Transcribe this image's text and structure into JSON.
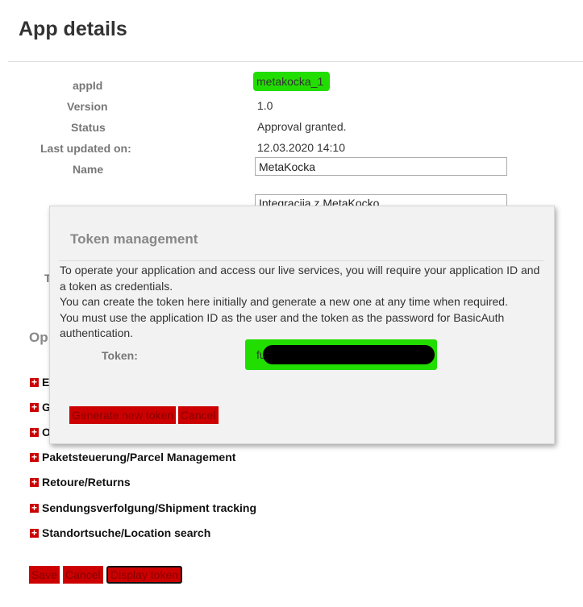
{
  "page": {
    "title": "App details"
  },
  "details": {
    "appid_label": "appId",
    "appid_value": "metakocka_1",
    "version_label": "Version",
    "version_value": "1.0",
    "status_label": "Status",
    "status_value": "Approval granted.",
    "updated_label": "Last updated on:",
    "updated_value": "12.03.2020 14:10",
    "name_label": "Name",
    "name_value": "MetaKocka",
    "description_value": "Integracija z MetaKocko"
  },
  "behind_modal": {
    "partial_label_t": "T",
    "partial_heading_op": "Op"
  },
  "operations": {
    "items": [
      {
        "label": "E"
      },
      {
        "label": "G"
      },
      {
        "label": "O"
      },
      {
        "label": "Paketsteuerung/Parcel Management"
      },
      {
        "label": "Retoure/Returns"
      },
      {
        "label": "Sendungsverfolgung/Shipment tracking"
      },
      {
        "label": "Standortsuche/Location search"
      }
    ]
  },
  "footer_buttons": {
    "save": "Save",
    "cancel": "Cancel",
    "display_token": "Display token"
  },
  "modal": {
    "title": "Token management",
    "line1": "To operate your application and access our live services, you will require your application ID and a token as credentials.",
    "line2": "You can create the token here initially and generate a new one at any time when required.",
    "line3": "You must use the application ID as the user and the token as the password for BasicAuth authentication.",
    "token_label": "Token:",
    "token_prefix": "fu",
    "generate_button": "Generate new token",
    "cancel_button": "Cancel"
  },
  "colors": {
    "accent_red": "#cc0000",
    "highlight_green": "#22dd00"
  }
}
